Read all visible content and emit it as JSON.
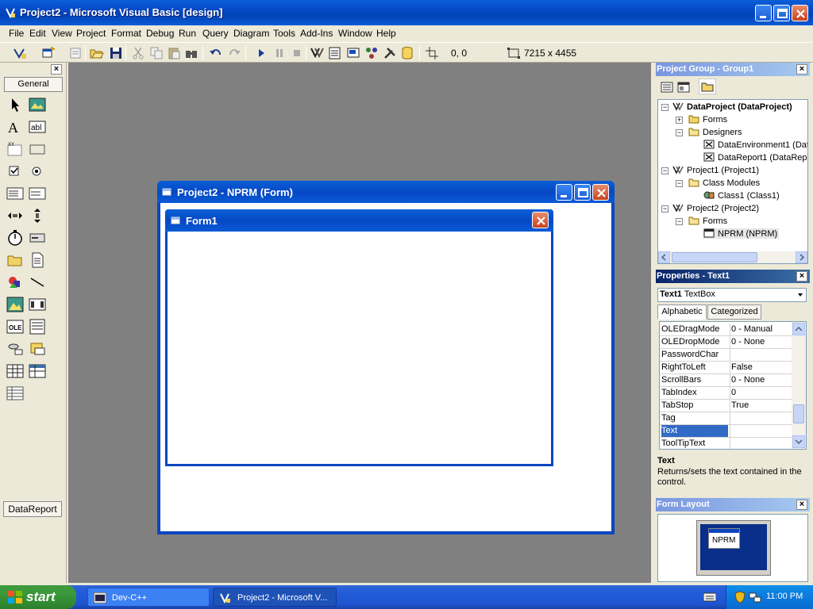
{
  "window": {
    "title": "Project2 - Microsoft Visual Basic [design]"
  },
  "menu": [
    "File",
    "Edit",
    "View",
    "Project",
    "Format",
    "Debug",
    "Run",
    "Query",
    "Diagram",
    "Tools",
    "Add-Ins",
    "Window",
    "Help"
  ],
  "toolbar": {
    "position": "0, 0",
    "size": "7215 x 4455"
  },
  "toolbox": {
    "tab": "General",
    "bottom_tab": "DataReport"
  },
  "form_window": {
    "title": "Project2 - NPRM (Form)"
  },
  "form1": {
    "title": "Form1"
  },
  "project_group": {
    "title": "Project Group - Group1",
    "tree": [
      {
        "label": "DataProject (DataProject)",
        "bold": true
      },
      {
        "label": "Forms"
      },
      {
        "label": "Designers"
      },
      {
        "label": "DataEnvironment1 (Dat"
      },
      {
        "label": "DataReport1 (DataRepo"
      },
      {
        "label": "Project1 (Project1)"
      },
      {
        "label": "Class Modules"
      },
      {
        "label": "Class1 (Class1)"
      },
      {
        "label": "Project2 (Project2)"
      },
      {
        "label": "Forms"
      },
      {
        "label": "NPRM (NPRM)"
      }
    ]
  },
  "properties": {
    "title": "Properties - Text1",
    "object_name": "Text1",
    "object_type": "TextBox",
    "tabs": [
      "Alphabetic",
      "Categorized"
    ],
    "rows": [
      {
        "name": "OLEDragMode",
        "value": "0 - Manual"
      },
      {
        "name": "OLEDropMode",
        "value": "0 - None"
      },
      {
        "name": "PasswordChar",
        "value": ""
      },
      {
        "name": "RightToLeft",
        "value": "False"
      },
      {
        "name": "ScrollBars",
        "value": "0 - None"
      },
      {
        "name": "TabIndex",
        "value": "0"
      },
      {
        "name": "TabStop",
        "value": "True"
      },
      {
        "name": "Tag",
        "value": ""
      },
      {
        "name": "Text",
        "value": ""
      },
      {
        "name": "ToolTipText",
        "value": ""
      }
    ],
    "description_title": "Text",
    "description_text": "Returns/sets the text contained in the control."
  },
  "form_layout": {
    "title": "Form Layout",
    "thumb_label": "NPRM"
  },
  "taskbar": {
    "start_label": "start",
    "tasks": [
      "Dev-C++",
      "Project2 - Microsoft V..."
    ],
    "clock": "11:00 PM"
  },
  "colors": {
    "title_blue": "#0a5fd8",
    "mdi_gray": "#808080",
    "selection": "#316ac5"
  }
}
